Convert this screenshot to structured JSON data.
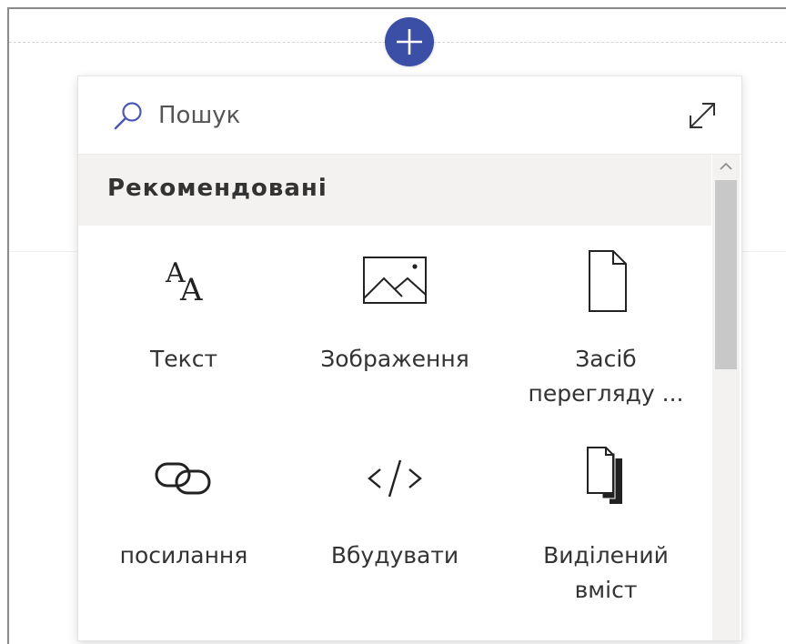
{
  "page": {
    "add_section_icon": "plus-icon",
    "accent_color": "#3c4fa6"
  },
  "toolbox": {
    "search": {
      "icon": "search-icon",
      "placeholder": "Пошук",
      "value": ""
    },
    "expand_icon": "expand-icon",
    "category": {
      "title": "Рекомендовані"
    },
    "scrollbar": {
      "up_arrow_icon": "chevron-up-icon"
    },
    "items": [
      {
        "icon": "text-icon",
        "label": "Текст"
      },
      {
        "icon": "image-icon",
        "label": "Зображення"
      },
      {
        "icon": "document-icon",
        "label": "Засіб\nперегляду ..."
      },
      {
        "icon": "link-icon",
        "label": "посилання"
      },
      {
        "icon": "code-icon",
        "label": "Вбудувати"
      },
      {
        "icon": "highlighted-content-icon",
        "label": "Виділений\nвміст"
      }
    ]
  }
}
